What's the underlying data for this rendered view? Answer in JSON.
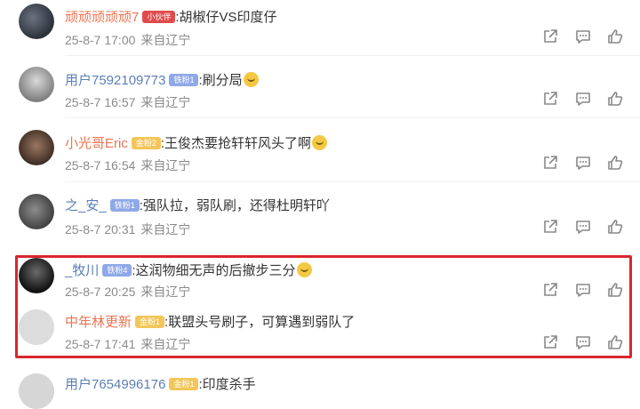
{
  "colors": {
    "username": "#eb7350",
    "meta": "#8a8a8a",
    "highlight_border": "#d9262c"
  },
  "icons": {
    "share": "share-icon",
    "reply": "comment-icon",
    "like": "thumbs-up-icon"
  },
  "comments": [
    {
      "username": "顽顽顽顽顽7",
      "badge": "小伙伴",
      "text": ":胡椒仔VS印度仔",
      "time": "25-8-7 17:00",
      "location": "来自辽宁"
    },
    {
      "username": "用户7592109773",
      "badge": "铁粉1",
      "text": ":刷分局",
      "time": "25-8-7 16:57",
      "location": "来自辽宁"
    },
    {
      "username": "小光哥Eric",
      "badge": "金粉2",
      "text": ":王俊杰要抢轩轩风头了啊",
      "time": "25-8-7 16:54",
      "location": "来自辽宁"
    },
    {
      "username": "之_安_",
      "badge": "铁粉1",
      "text": ":强队拉，弱队刷，还得杜明轩吖",
      "time": "25-8-7 20:31",
      "location": "来自辽宁"
    },
    {
      "username": "_牧川",
      "badge": "铁粉4",
      "text": ":这润物细无声的后撤步三分",
      "time": "25-8-7 20:25",
      "location": "来自辽宁"
    },
    {
      "username": "中年林更新",
      "badge": "金粉1",
      "text": ":联盟头号刷子，可算遇到弱队了",
      "time": "25-8-7 17:41",
      "location": "来自辽宁"
    },
    {
      "username": "用户7654996176",
      "badge": "金粉1",
      "text": ":印度杀手",
      "time": "",
      "location": ""
    }
  ]
}
